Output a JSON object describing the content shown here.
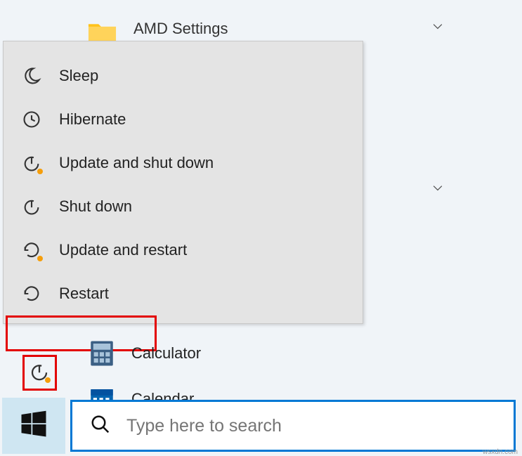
{
  "background": {
    "folder_label": "AMD Settings"
  },
  "power_menu": {
    "items": [
      {
        "label": "Sleep"
      },
      {
        "label": "Hibernate"
      },
      {
        "label": "Update and shut down"
      },
      {
        "label": "Shut down"
      },
      {
        "label": "Update and restart"
      },
      {
        "label": "Restart"
      }
    ]
  },
  "start_apps": {
    "calculator": "Calculator",
    "calendar": "Calendar"
  },
  "search": {
    "placeholder": "Type here to search"
  },
  "watermark": "wsxdn.com"
}
